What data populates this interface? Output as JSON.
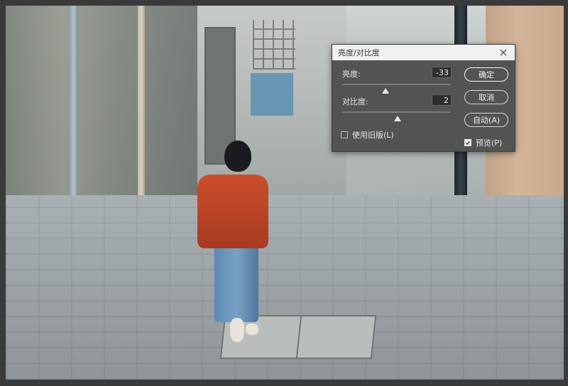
{
  "dialog": {
    "title": "亮度/对比度",
    "brightness": {
      "label": "亮度:",
      "value": "-33",
      "slider_fraction": 0.4
    },
    "contrast": {
      "label": "对比度:",
      "value": "2",
      "slider_fraction": 0.51
    },
    "legacy": {
      "label": "使用旧版(L)",
      "checked": false
    },
    "buttons": {
      "ok": "确定",
      "cancel": "取消",
      "auto": "自动(A)"
    },
    "preview": {
      "label": "预览(P)",
      "checked": true
    }
  },
  "icons": {
    "close": "close-icon",
    "check": "check-icon"
  },
  "colors": {
    "dialog_bg": "#535353",
    "titlebar_bg": "#f0f0f0",
    "sweater": "#c94a2a",
    "jeans": "#6f97be"
  }
}
